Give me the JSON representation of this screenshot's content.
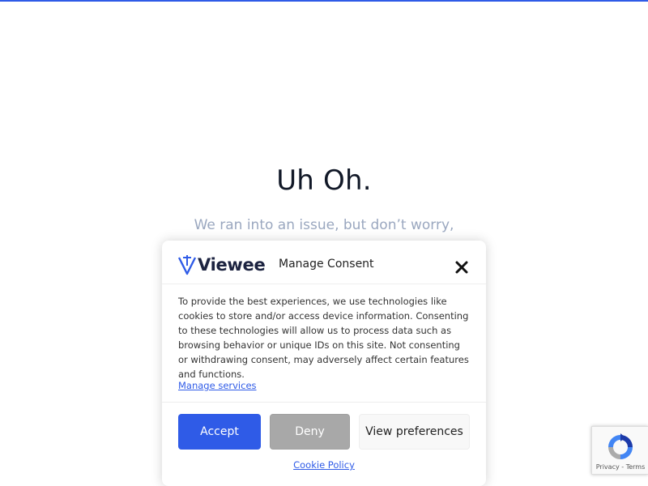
{
  "page": {
    "title": "Uh Oh.",
    "message_line1": "We ran into an issue, but don’t worry,"
  },
  "consent": {
    "brand": "Viewee",
    "title": "Manage Consent",
    "body": "To provide the best experiences, we use technologies like cookies to store and/or access device information. Consenting to these technologies will allow us to process data such as browsing behavior or unique IDs on this site. Not consenting or withdrawing consent, may adversely affect certain features and functions.",
    "manage_services": "Manage services",
    "accept_label": "Accept",
    "deny_label": "Deny",
    "preferences_label": "View preferences",
    "cookie_policy": "Cookie Policy"
  },
  "recaptcha": {
    "privacy": "Privacy",
    "separator": " - ",
    "terms": "Terms"
  },
  "colors": {
    "accent": "#2f5be7",
    "deny": "#a8a8a8",
    "message": "#9aa7bf"
  },
  "icons": {
    "close": "close-icon",
    "logo": "viewee-logo-icon",
    "recaptcha": "recaptcha-icon"
  }
}
